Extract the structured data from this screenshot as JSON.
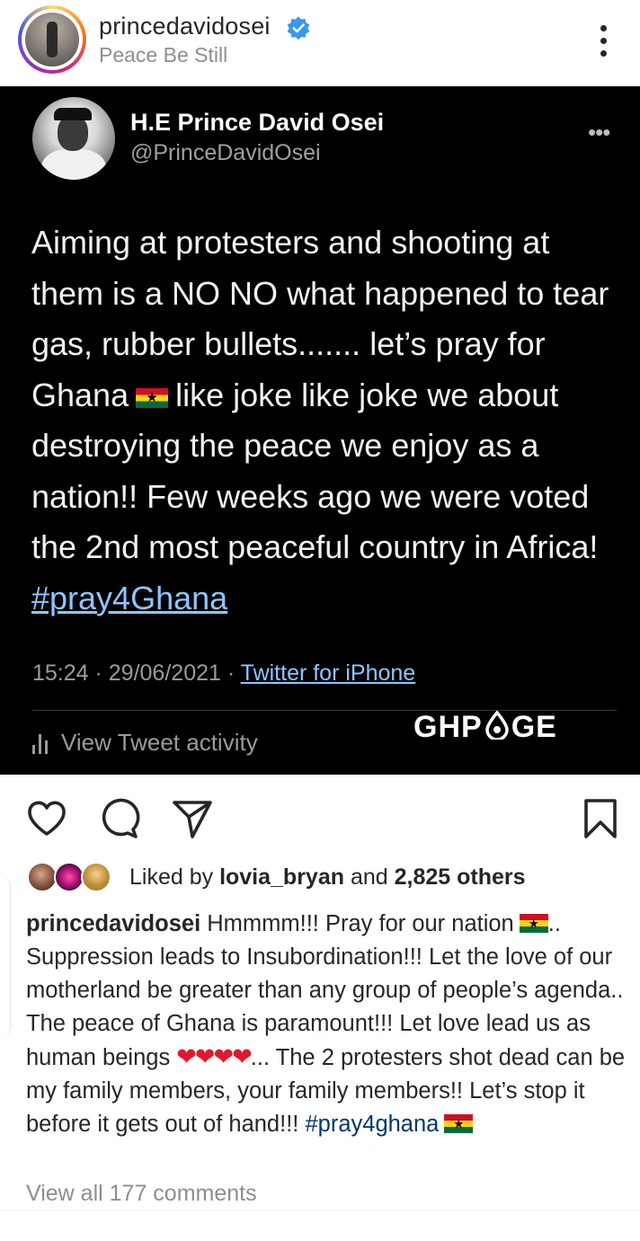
{
  "post_header": {
    "username": "princedavidosei",
    "subtitle": "Peace Be Still",
    "verified_icon": "verified-badge-icon",
    "more_icon": "more-vertical-icon"
  },
  "tweet": {
    "display_name": "H.E Prince David Osei",
    "handle": "@PrinceDavidOsei",
    "text_before_flag": "Aiming at protesters and shooting at them is a NO NO what happened to tear gas, rubber bullets....... let’s pray for Ghana",
    "text_after_flag": "like joke like joke we about destroying the peace we enjoy as a nation!! Few weeks ago we were voted the 2nd most peaceful country in Africa!",
    "hashtag": "#pray4Ghana",
    "timestamp": "15:24 · 29/06/2021 · ",
    "source": "Twitter for iPhone",
    "activity": "View Tweet activity",
    "watermark_left": "GHP",
    "watermark_right": "GE",
    "flag_icon": "ghana-flag-icon"
  },
  "actions": {
    "like_icon": "heart-icon",
    "comment_icon": "comment-icon",
    "share_icon": "send-icon",
    "save_icon": "bookmark-icon"
  },
  "likes": {
    "prefix": "Liked by ",
    "user": "lovia_bryan",
    "middle": " and ",
    "count": "2,825 others"
  },
  "caption": {
    "username": "princedavidosei",
    "part1": " Hmmmm!!! Pray for our nation",
    "part2": ".. Suppression leads to Insubordination!!! Let  the love of our motherland be greater than any group of people’s agenda.. The peace of Ghana is paramount!!! Let love lead us as human beings ",
    "hearts": "❤❤❤❤",
    "part3": "... The 2 protesters shot dead can be my family members, your family members!! Let’s stop it before it gets out of hand!!! ",
    "hashtag": "#pray4ghana"
  },
  "comments": {
    "view_all": "View all 177 comments"
  },
  "colors": {
    "tweet_bg": "#000000",
    "link_blue": "#8ec5ff",
    "hashtag_blue": "#00376b",
    "verified_blue": "#3897f0",
    "heart_red": "#e0182f"
  }
}
